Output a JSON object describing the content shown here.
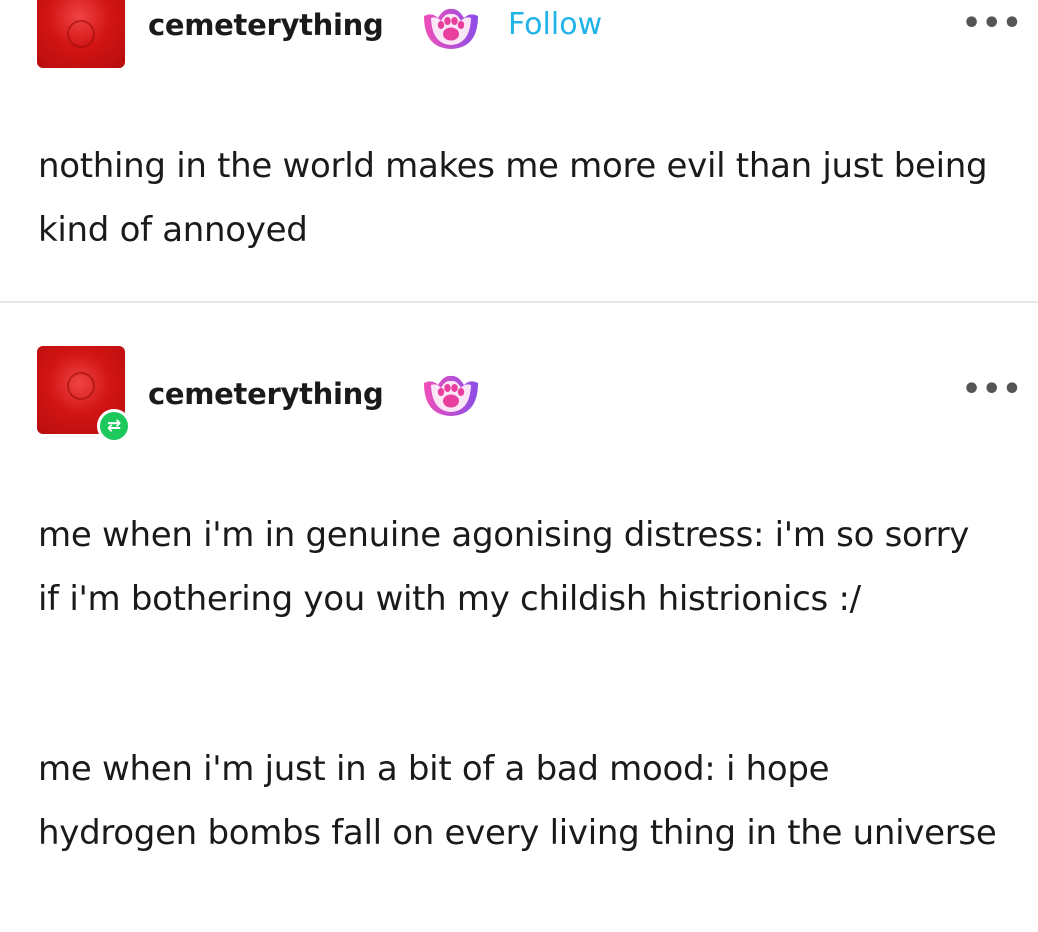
{
  "posts": [
    {
      "username": "cemeterything",
      "follow_label": "Follow",
      "more_label": "•••",
      "badge_icon": "paw-badge-icon",
      "body": "nothing in the world makes me more evil than just being kind of annoyed"
    },
    {
      "username": "cemeterything",
      "more_label": "•••",
      "badge_icon": "paw-badge-icon",
      "reblog_icon": "reblog-icon",
      "paragraphs": [
        "me when i'm in genuine agonising distress: i'm so sorry if i'm bothering you with my childish histrionics :/",
        "me when i'm just in a bit of a bad mood: i hope hydrogen bombs fall on every living thing in the universe"
      ]
    }
  ],
  "colors": {
    "avatar": "#d21414",
    "follow": "#1fb3e8",
    "reblog_badge": "#1ec95c",
    "paw_gradient_start": "#f04fb8",
    "paw_gradient_end": "#8b4de8"
  }
}
